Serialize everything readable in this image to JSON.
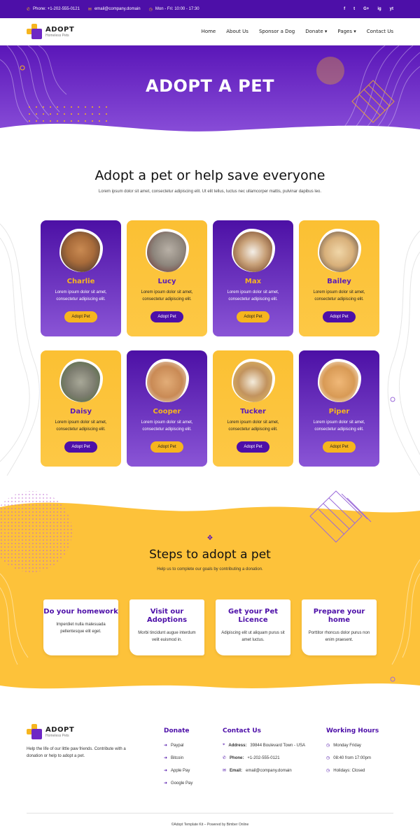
{
  "topbar": {
    "phone": "Phone: +1-202-555-0121",
    "email": "email@company.domain",
    "hours": "Mon - Fri: 10:00 - 17:30",
    "social": [
      "f",
      "t",
      "G+",
      "ig",
      "yt"
    ]
  },
  "header": {
    "logo_title": "ADOPT",
    "logo_subtitle": "Homeless Pets",
    "nav": [
      "Home",
      "About Us",
      "Sponsor a Dog",
      "Donate ▾",
      "Pages ▾",
      "Contact Us"
    ]
  },
  "hero": {
    "title": "ADOPT A PET"
  },
  "intro": {
    "title": "Adopt a pet or help save everyone",
    "text": "Lorem ipsum dolor sit amet, consectetur adipiscing elit. Ut elit tellus, luctus nec ullamcorper mattis, pulvinar dapibus leo."
  },
  "pets": [
    {
      "name": "Charlie",
      "desc": "Lorem ipsum dolor sit amet, consectetur adipiscing elit.",
      "button": "Adopt Pet",
      "theme": "purple",
      "color": "#a86b3a"
    },
    {
      "name": "Lucy",
      "desc": "Lorem ipsum dolor sit amet, consectetur adipiscing elit.",
      "button": "Adopt Pet",
      "theme": "yellow",
      "color": "#9a8f84"
    },
    {
      "name": "Max",
      "desc": "Lorem ipsum dolor sit amet, consectetur adipiscing elit.",
      "button": "Adopt Pet",
      "theme": "purple",
      "color": "#8a5530"
    },
    {
      "name": "Bailey",
      "desc": "Lorem ipsum dolor sit amet, consectetur adipiscing elit.",
      "button": "Adopt Pet",
      "theme": "yellow",
      "color": "#d8b07a"
    },
    {
      "name": "Daisy",
      "desc": "Lorem ipsum dolor sit amet, consectetur adipiscing elit.",
      "button": "Adopt Pet",
      "theme": "yellow",
      "color": "#8a8a7a"
    },
    {
      "name": "Cooper",
      "desc": "Lorem ipsum dolor sit amet, consectetur adipiscing elit.",
      "button": "Adopt Pet",
      "theme": "purple",
      "color": "#c98a55"
    },
    {
      "name": "Tucker",
      "desc": "Lorem ipsum dolor sit amet, consectetur adipiscing elit.",
      "button": "Adopt Pet",
      "theme": "yellow",
      "color": "#c2935e"
    },
    {
      "name": "Piper",
      "desc": "Lorem ipsum dolor sit amet, consectetur adipiscing elit.",
      "button": "Adopt Pet",
      "theme": "purple",
      "color": "#d89a55"
    }
  ],
  "steps": {
    "title": "Steps to adopt a pet",
    "subtitle": "Help us to complete our goals by contributing a donation.",
    "items": [
      {
        "title": "Do your homework",
        "text": "Imperdiet nulla malesuada pellentesque elit eget."
      },
      {
        "title": "Visit our Adoptions",
        "text": "Morbi tincidunt augue interdum velit euismod in."
      },
      {
        "title": "Get your Pet Licence",
        "text": "Adipiscing elit ut aliquam purus sit amet luctus."
      },
      {
        "title": "Prepare your home",
        "text": "Porttitor rhoncus dolor purus non enim praesent."
      }
    ]
  },
  "footer": {
    "about": "Help the life of our little paw friends. Contribute with a donation or help to adopt a pet.",
    "donate_title": "Donate",
    "donate": [
      "Paypal",
      "Bitcoin",
      "Apple Pay",
      "Google Pay"
    ],
    "contact_title": "Contact Us",
    "contact": [
      {
        "label": "Address:",
        "value": "39844 Boulevard Town - USA"
      },
      {
        "label": "Phone:",
        "value": "+1-202-555-0121"
      },
      {
        "label": "Email:",
        "value": "email@company.domain"
      }
    ],
    "hours_title": "Working Hours",
    "hours": [
      "Monday Friday",
      "08:40 from 17:00pm",
      "Holidays: Closed"
    ],
    "copyright": "©Adopt Template Kit – Powered by Bimber Online"
  },
  "colors": {
    "purple": "#4d0fa8",
    "yellow": "#f6b51e"
  }
}
